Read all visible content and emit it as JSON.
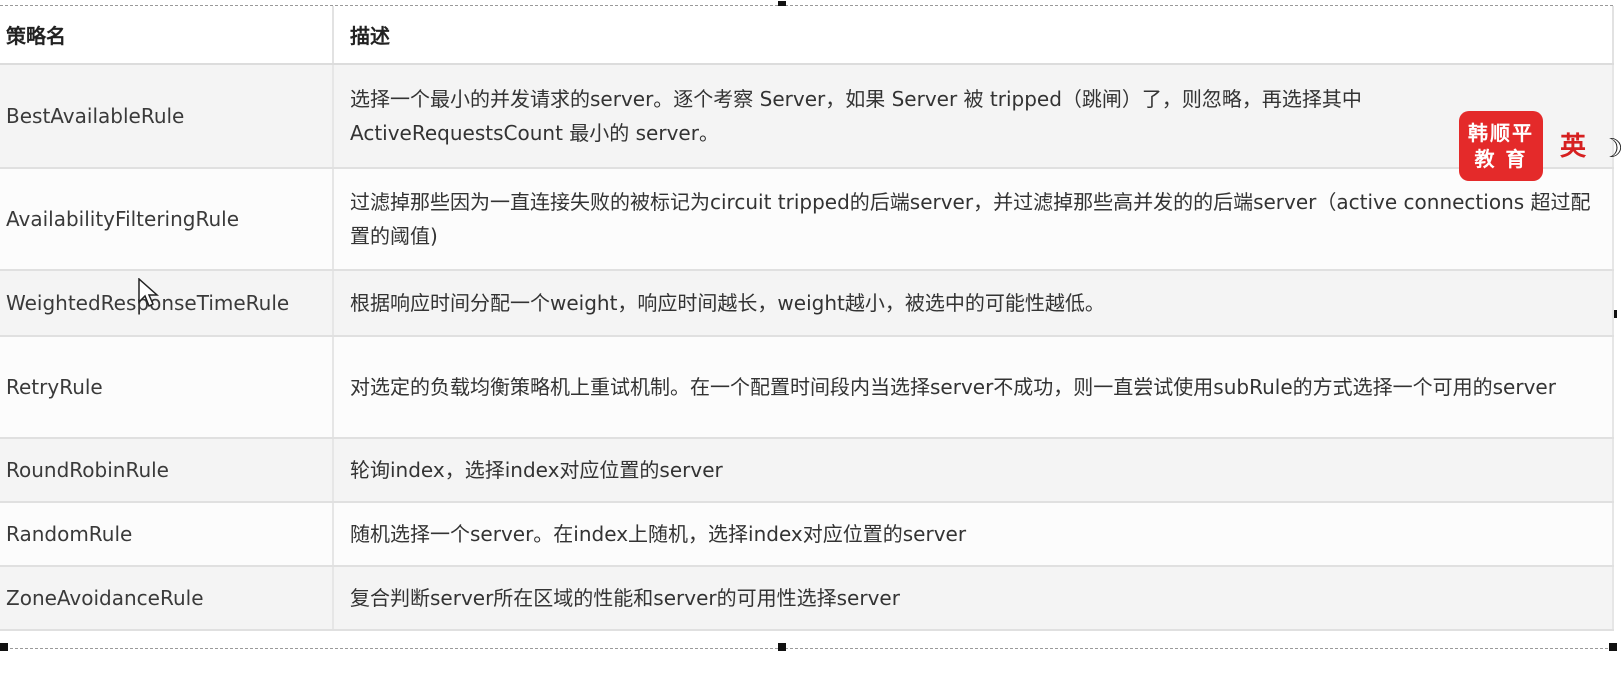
{
  "table": {
    "headers": {
      "name": "策略名",
      "description": "描述"
    },
    "rows": [
      {
        "name": "BestAvailableRule",
        "description": "选择一个最小的并发请求的server。逐个考察 Server，如果 Server 被 tripped（跳闸）了，则忽略，再选择其中 ActiveRequestsCount 最小的 server。"
      },
      {
        "name": "AvailabilityFilteringRule",
        "description": "过滤掉那些因为一直连接失败的被标记为circuit tripped的后端server，并过滤掉那些高并发的的后端server（active connections 超过配置的阈值)"
      },
      {
        "name": "WeightedResponseTimeRule",
        "description": "根据响应时间分配一个weight，响应时间越长，weight越小，被选中的可能性越低。"
      },
      {
        "name": "RetryRule",
        "description": "对选定的负载均衡策略机上重试机制。在一个配置时间段内当选择server不成功，则一直尝试使用subRule的方式选择一个可用的server"
      },
      {
        "name": "RoundRobinRule",
        "description": "轮询index，选择index对应位置的server"
      },
      {
        "name": "RandomRule",
        "description": "随机选择一个server。在index上随机，选择index对应位置的server"
      },
      {
        "name": "ZoneAvoidanceRule",
        "description": "复合判断server所在区域的性能和server的可用性选择server"
      }
    ]
  },
  "watermark": {
    "line1": "韩顺平",
    "line2": "教 育",
    "extra": "英",
    "moon_icon": "moon-icon",
    "color": "#e42a2a"
  },
  "cursor_icon": "arrow-cursor-icon"
}
